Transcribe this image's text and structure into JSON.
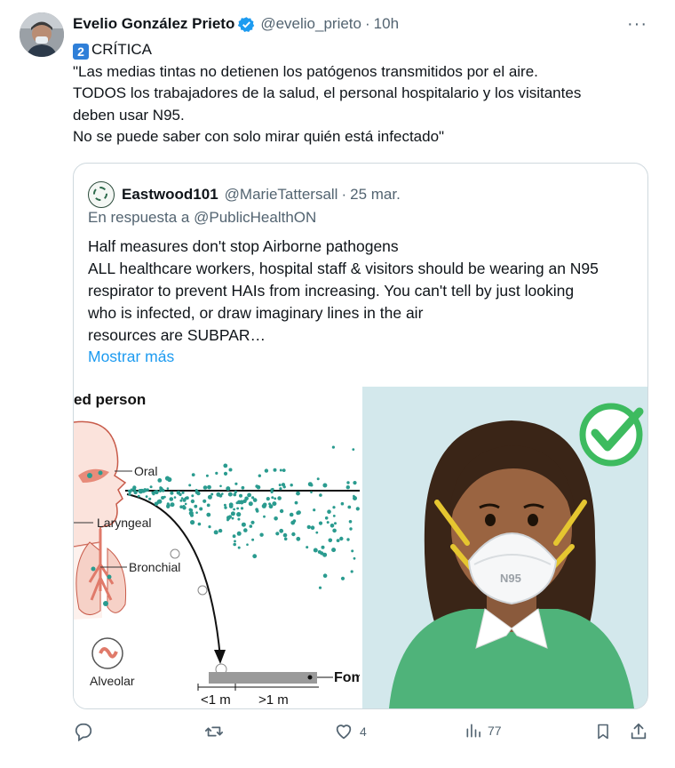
{
  "tweet": {
    "display_name": "Evelio González Prieto",
    "handle": "@evelio_prieto",
    "separator": "·",
    "time": "10h",
    "more_label": "···",
    "badge_number": "2",
    "lines": [
      "CRÍTICA",
      "\"Las medias tintas no detienen los patógenos transmitidos por el aire.",
      "TODOS los trabajadores de la salud, el personal hospitalario y los visitantes",
      "deben usar N95.",
      "No se puede saber con solo mirar quién está infectado\""
    ]
  },
  "quote": {
    "display_name": "Eastwood101",
    "handle": "@MarieTattersall",
    "separator": "·",
    "date": "25 mar.",
    "reply_prefix": "En respuesta a",
    "reply_to": "@PublicHealthON",
    "lines": [
      "Half measures don't stop Airborne pathogens",
      "ALL healthcare workers, hospital staff & visitors should be wearing an N95",
      "respirator to prevent HAIs from increasing. You can't tell by just looking",
      "who is infected, or draw imaginary lines in the air",
      "resources are SUBPAR…"
    ],
    "show_more": "Mostrar más",
    "diagram": {
      "title": "ed person",
      "labels": {
        "oral": "Oral",
        "laryngeal": "Laryngeal",
        "bronchial": "Bronchial",
        "alveolar": "Alveolar",
        "fomite": "Fom",
        "near": "<1 m",
        "far": ">1 m"
      }
    },
    "mask_label": "N95"
  },
  "actions": {
    "replies": "",
    "retweets": "",
    "likes": "4",
    "views": "77"
  },
  "colors": {
    "link": "#1d9bf0",
    "muted": "#536471",
    "verified": "#1d9bf0",
    "check": "#3dbb5f",
    "shirt": "#4fb37a",
    "aerosol": "#2a9b8f"
  }
}
